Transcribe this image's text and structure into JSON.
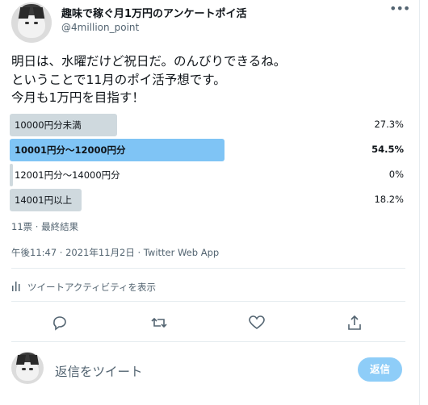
{
  "tweet": {
    "display_name": "趣味で稼ぐ月1万円のアンケートポイ活",
    "handle": "@4million_point",
    "text_lines": [
      "明日は、水曜だけど祝日だ。のんびりできるね。",
      "ということで11月のポイ活予想です。",
      "今月も1万円を目指す！"
    ],
    "timestamp": "午後11:47 · 2021年11月2日 · Twitter Web App"
  },
  "poll": {
    "options": [
      {
        "label": "10000円分未満",
        "percent": "27.3%",
        "fraction": 0.273,
        "winner": false
      },
      {
        "label": "10001円分～12000円分",
        "percent": "54.5%",
        "fraction": 0.545,
        "winner": true
      },
      {
        "label": "12001円分～14000円分",
        "percent": "0%",
        "fraction": 0.0,
        "winner": false
      },
      {
        "label": "14001円以上",
        "percent": "18.2%",
        "fraction": 0.182,
        "winner": false
      }
    ],
    "meta": "11票 · 最終結果"
  },
  "activity": {
    "label": "ツイートアクティビティを表示"
  },
  "actions": {
    "icons": [
      "reply-icon",
      "retweet-icon",
      "like-icon",
      "share-icon"
    ]
  },
  "reply_box": {
    "placeholder": "返信をツイート",
    "button_label": "返信"
  },
  "colors": {
    "winner_bar": "#7fc4f5",
    "bar": "#cfd9de",
    "reply_button": "#8ecdf8",
    "secondary_text": "#536471"
  }
}
